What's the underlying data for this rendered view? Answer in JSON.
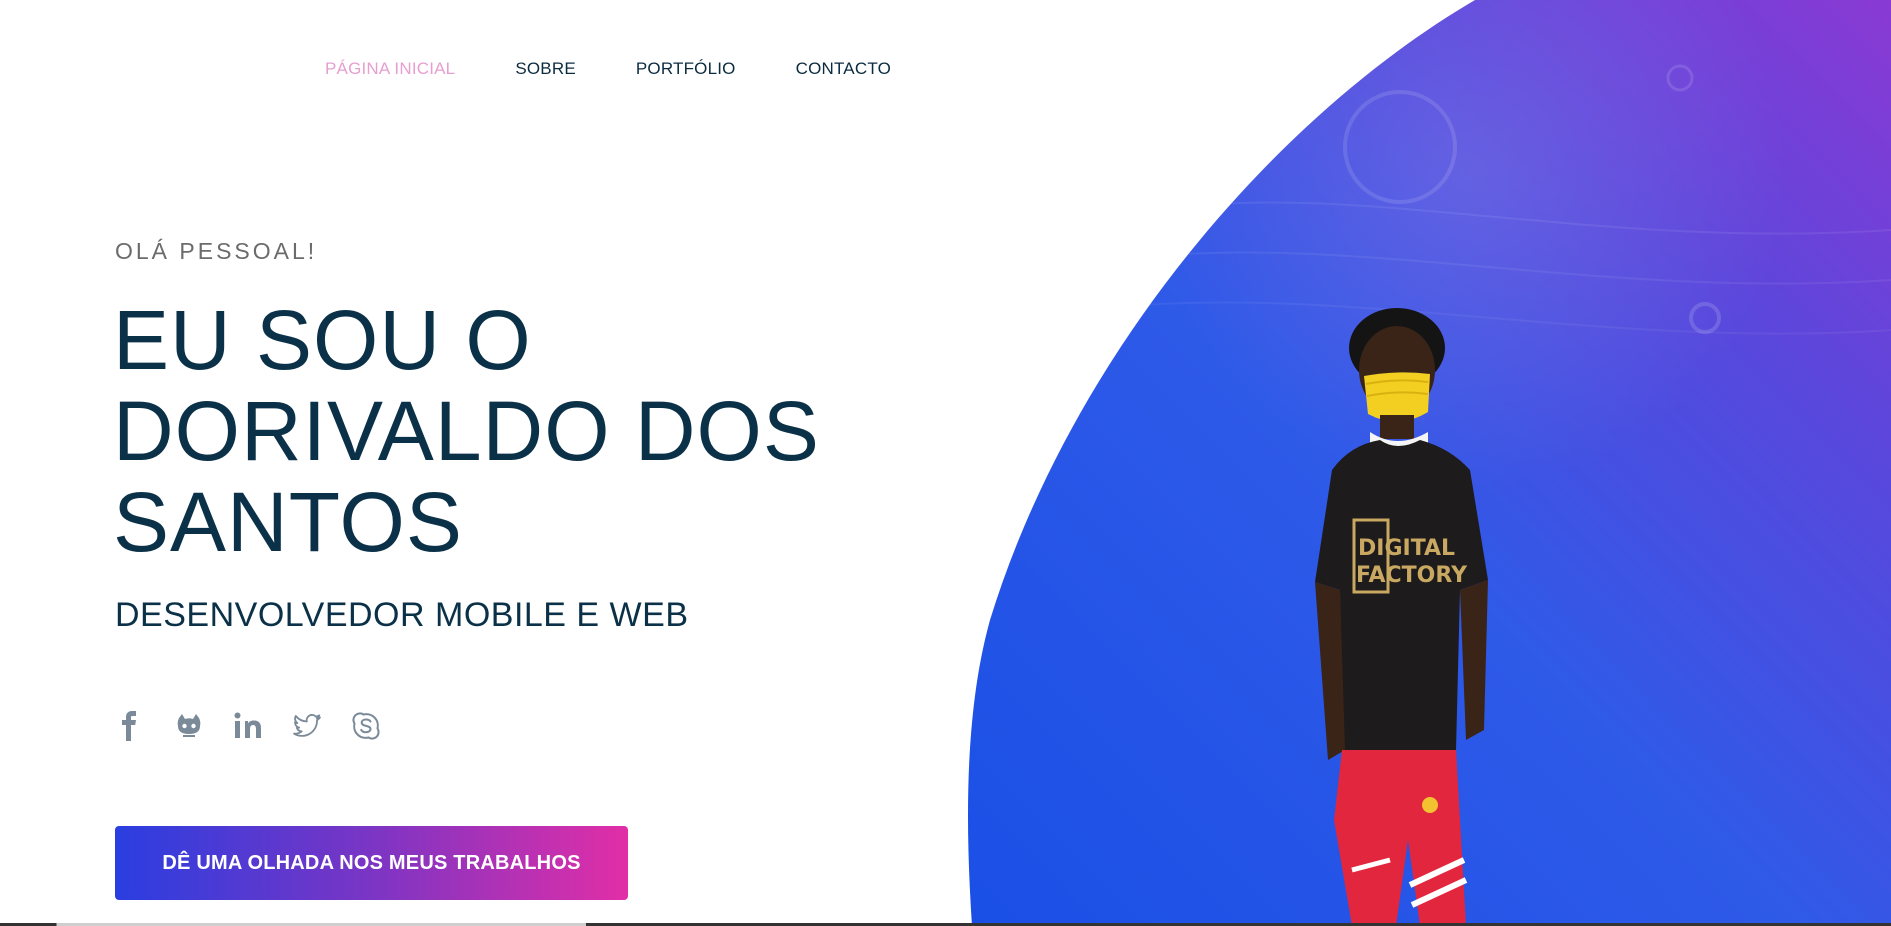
{
  "nav": {
    "items": [
      {
        "label": "PÁGINA INICIAL",
        "active": true
      },
      {
        "label": "SOBRE",
        "active": false
      },
      {
        "label": "PORTFÓLIO",
        "active": false
      },
      {
        "label": "CONTACTO",
        "active": false
      }
    ]
  },
  "hero": {
    "greeting": "OLÁ PESSOAL!",
    "headline_line1": "EU SOU O",
    "headline_line2": "DORIVALDO DOS",
    "headline_line3": "SANTOS",
    "subtitle": "DESENVOLVEDOR MOBILE E WEB",
    "socials": [
      {
        "icon": "facebook-icon"
      },
      {
        "icon": "github-icon"
      },
      {
        "icon": "linkedin-icon"
      },
      {
        "icon": "twitter-icon"
      },
      {
        "icon": "skype-icon"
      }
    ],
    "cta_label": "DÊ UMA OLHADA NOS MEUS TRABALHOS",
    "photo_shirt_text_1": "DIGITAL",
    "photo_shirt_text_2": "FACTORY"
  },
  "colors": {
    "nav_active": "#e69fd0",
    "heading": "#0b3148",
    "blob_start": "#1f55e6",
    "blob_end": "#7a3fd6",
    "cta_start": "#2a3ee0",
    "cta_end": "#e22ea7"
  }
}
